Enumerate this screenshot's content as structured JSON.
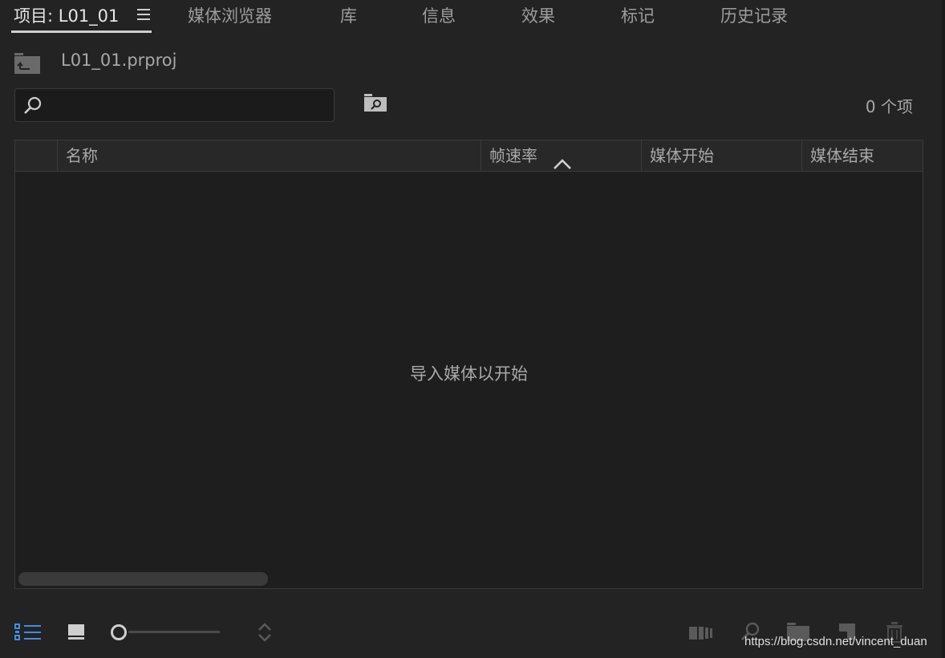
{
  "tabs": [
    {
      "label": "项目: L01_01",
      "active": true
    },
    {
      "label": "媒体浏览器"
    },
    {
      "label": "库"
    },
    {
      "label": "信息"
    },
    {
      "label": "效果"
    },
    {
      "label": "标记"
    },
    {
      "label": "历史记录"
    }
  ],
  "project": {
    "file_name": "L01_01.prproj"
  },
  "search": {
    "value": "",
    "placeholder": ""
  },
  "items_count": "0 个项",
  "table": {
    "columns": [
      "名称",
      "帧速率",
      "媒体开始",
      "媒体结束"
    ],
    "sorted_column": "帧速率",
    "sort_direction": "ascending",
    "rows": [],
    "empty_message": "导入媒体以开始"
  },
  "icons": {
    "hamburger": "panel-menu-icon",
    "project": "project-folder-icon",
    "search": "search-icon",
    "bin_search": "new-search-bin-icon",
    "sort": "sort-ascending-icon",
    "list_view": "list-view-icon",
    "icon_view": "icon-view-icon",
    "sort_icons": "sort-icons-icon",
    "automate": "automate-to-sequence-icon",
    "find": "find-icon",
    "new_bin": "new-bin-icon",
    "new_item": "new-item-icon",
    "clear": "trash-icon"
  },
  "colors": {
    "accent": "#3d8ee6",
    "background": "#232323",
    "panel": "#1e1e1e"
  },
  "watermark": "https://blog.csdn.net/vincent_duan"
}
